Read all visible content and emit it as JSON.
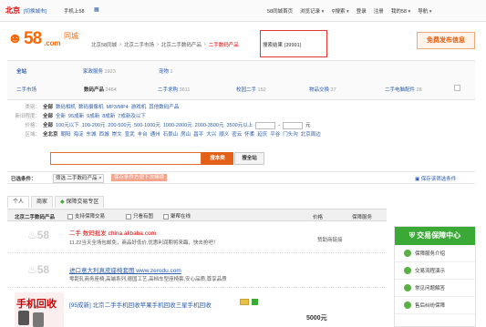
{
  "topbar": {
    "city": "北京",
    "switch_city": "[切换城市]",
    "mobile": "手机上58",
    "links": [
      "58同城首页",
      "浏览记录",
      "搜索",
      "登录",
      "注册",
      "我的58",
      "导航"
    ]
  },
  "header": {
    "logo_text": "58",
    "logo_com": ".com",
    "logo_cn": "同城",
    "breadcrumb": [
      "北京58同城",
      "北京二手市场",
      "北京二手数码产品",
      "二手数码产品"
    ],
    "result_count": "搜索结果 (39991)",
    "post_button": "免费发布信息"
  },
  "catnav": {
    "all": "全站",
    "row1": [
      {
        "label": "家政服务",
        "count": "1923"
      },
      {
        "label": "宠物",
        "count": "1"
      }
    ],
    "row2": [
      {
        "label": "二手市场",
        "count": ""
      },
      {
        "label": "数码产品",
        "count": "2464"
      },
      {
        "label": "二手求购",
        "count": "3611"
      },
      {
        "label": "校园二手",
        "count": "152"
      },
      {
        "label": "物品交换",
        "count": "37"
      },
      {
        "label": "二手电脑配件",
        "count": "28"
      }
    ]
  },
  "filters": {
    "type_label": "类别：",
    "type_all": "全部",
    "types": [
      "数码相机",
      "数码摄像机",
      "MP3/MP4",
      "游戏机",
      "其他数码产品"
    ],
    "cond_label": "新旧程度：",
    "cond_all": "全部",
    "conds": [
      "全新",
      "95成新",
      "9成新",
      "8成新",
      "7成新及以下"
    ],
    "price_label": "价格：",
    "price_all": "全部",
    "prices": [
      "100元以下",
      "100-200元",
      "200-500元",
      "500-1000元",
      "1000-2000元",
      "2000-3500元",
      "3500元以上"
    ],
    "price_unit": "元",
    "area_label": "区域：",
    "area_all": "全北京",
    "areas": [
      "朝阳",
      "海淀",
      "东城",
      "西城",
      "崇文",
      "宣武",
      "丰台",
      "通州",
      "石景山",
      "房山",
      "昌平",
      "大兴",
      "顺义",
      "密云",
      "怀柔",
      "延庆",
      "平谷",
      "门头沟",
      "北京周边"
    ]
  },
  "search": {
    "search_button": "搜本类",
    "site_button": "搜全站"
  },
  "selected": {
    "label": "已选条件：",
    "chip": "筛选 二手数码产品",
    "save_tip": "保存条件方便下次继续",
    "save_link": "保存该筛选条件"
  },
  "tabs": [
    "个人",
    "商家",
    "保障交易专区"
  ],
  "list_header": {
    "title": "北京二手数码产品",
    "opts": [
      "支持保障交易",
      "只看有图",
      "聚帮在线"
    ],
    "col_price": "价格",
    "col_guard": "保障服务"
  },
  "items": [
    {
      "title": "二手 数码批发 china.alibaba.com",
      "desc": "11.22当天全场包邮免，商品好低价,优惠利润期将来臨，快去抢吧！",
      "tag": "赞助商链接"
    },
    {
      "title": "进口意大利真皮座椅套图 www.zerodu.com",
      "desc": "零距轧商务座椅,高端系列,德国工艺,高档车型座椅套,安心品质,尊享品质"
    },
    {
      "title": "[95成新] 北京二手手机回收苹果手机回收三星手机回收",
      "img_text": "手机回收",
      "price": "5000元"
    }
  ],
  "sidebar": {
    "title": "交易保障中心",
    "items": [
      "保障服务介绍",
      "交易流程演示",
      "常见问题解答",
      "售后纠纷保障"
    ]
  },
  "colors": {
    "accent": "#e45f17",
    "link": "#2b5bab",
    "green": "#3ba936"
  }
}
